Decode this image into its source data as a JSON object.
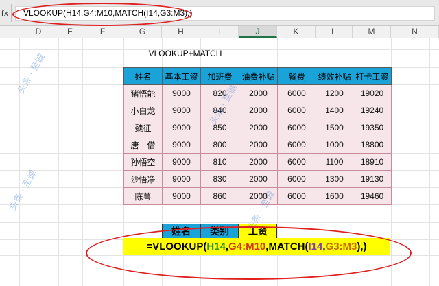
{
  "formula_bar": {
    "fx": "fx",
    "formula": "=VLOOKUP(H14,G4:M10,MATCH(I14,G3:M3),)"
  },
  "columns": [
    "D",
    "E",
    "F",
    "G",
    "H",
    "I",
    "J",
    "K",
    "L",
    "M",
    "N"
  ],
  "sheet_title": "VLOOKUP+MATCH",
  "table": {
    "headers": [
      "姓名",
      "基本工资",
      "加班费",
      "油费补贴",
      "餐费",
      "绩效补贴",
      "打卡工资"
    ],
    "rows": [
      [
        "猪悟能",
        "9000",
        "820",
        "2000",
        "6000",
        "1200",
        "19020"
      ],
      [
        "小白龙",
        "9000",
        "840",
        "2000",
        "6000",
        "1400",
        "19240"
      ],
      [
        "魏征",
        "9000",
        "850",
        "2000",
        "6000",
        "1500",
        "19350"
      ],
      [
        "唐　僧",
        "9000",
        "800",
        "2000",
        "6000",
        "1000",
        "18800"
      ],
      [
        "孙悟空",
        "9000",
        "810",
        "2000",
        "6000",
        "1100",
        "18910"
      ],
      [
        "沙悟净",
        "9000",
        "830",
        "2000",
        "6000",
        "1300",
        "19130"
      ],
      [
        "陈萼",
        "9000",
        "860",
        "2000",
        "6000",
        "1600",
        "19460"
      ]
    ]
  },
  "lookup": {
    "headers": [
      "姓名",
      "类别",
      "工资"
    ]
  },
  "formula_display": {
    "p1": "=VLOOKUP(",
    "r1": "H14",
    "c1": ",",
    "r2": "G4:M10",
    "c2": ",MATCH(",
    "r3": "I14",
    "c3": ",",
    "r4": "G3:M3",
    "c4": "),)"
  },
  "colors": {
    "header_blue": "#1aa3d9",
    "lookup_yellow": "#ffff00",
    "annotation_red": "#e02020"
  },
  "watermark": "头条 · 至诚"
}
